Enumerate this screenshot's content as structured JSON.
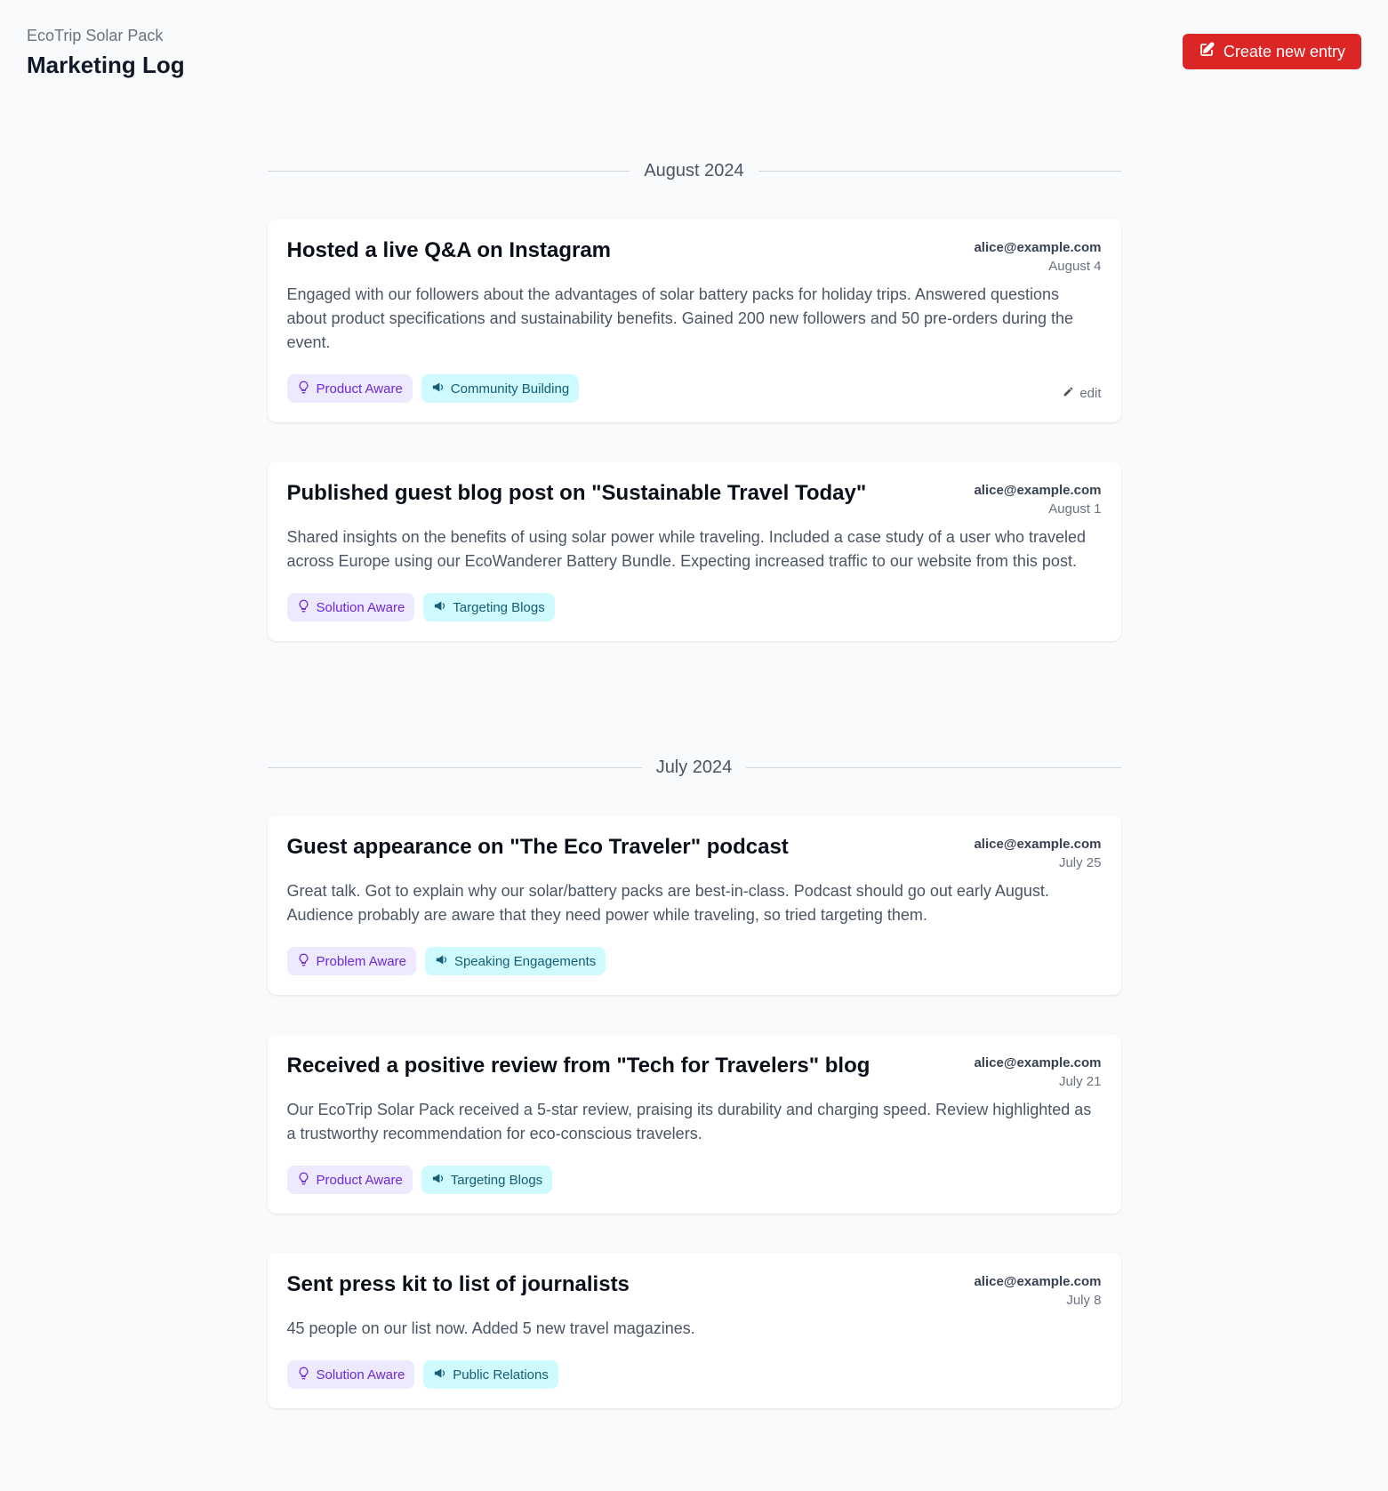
{
  "header": {
    "brand": "EcoTrip Solar Pack",
    "title": "Marketing Log",
    "create_button": "Create new entry"
  },
  "colors": {
    "accent": "#dc2626",
    "awareness_tag_bg": "#ede9fe",
    "awareness_tag_text": "#6d28d9",
    "channel_tag_bg": "#cffafe",
    "channel_tag_text": "#155e75"
  },
  "months": [
    {
      "label": "August 2024",
      "entries": [
        {
          "title": "Hosted a live Q&A on Instagram",
          "author": "alice@example.com",
          "date": "August 4",
          "body": "Engaged with our followers about the advantages of solar battery packs for holiday trips. Answered questions about product specifications and sustainability benefits. Gained 200 new followers and 50 pre-orders during the event.",
          "awareness": {
            "icon": "lightbulb-icon",
            "label": "Product Aware"
          },
          "channel": {
            "icon": "megaphone-icon",
            "label": "Community Building"
          },
          "edit_label": "edit"
        },
        {
          "title": "Published guest blog post on \"Sustainable Travel Today\"",
          "author": "alice@example.com",
          "date": "August 1",
          "body": "Shared insights on the benefits of using solar power while traveling. Included a case study of a user who traveled across Europe using our EcoWanderer Battery Bundle. Expecting increased traffic to our website from this post.",
          "awareness": {
            "icon": "lightbulb-icon",
            "label": "Solution Aware"
          },
          "channel": {
            "icon": "megaphone-icon",
            "label": "Targeting Blogs"
          }
        }
      ]
    },
    {
      "label": "July 2024",
      "entries": [
        {
          "title": "Guest appearance on \"The Eco Traveler\" podcast",
          "author": "alice@example.com",
          "date": "July 25",
          "body": "Great talk. Got to explain why our solar/battery packs are best-in-class. Podcast should go out early August. Audience probably are aware that they need power while traveling, so tried targeting them.",
          "awareness": {
            "icon": "lightbulb-icon",
            "label": "Problem Aware"
          },
          "channel": {
            "icon": "megaphone-icon",
            "label": "Speaking Engagements"
          }
        },
        {
          "title": "Received a positive review from \"Tech for Travelers\" blog",
          "author": "alice@example.com",
          "date": "July 21",
          "body": "Our EcoTrip Solar Pack received a 5-star review, praising its durability and charging speed. Review highlighted as a trustworthy recommendation for eco-conscious travelers.",
          "awareness": {
            "icon": "lightbulb-icon",
            "label": "Product Aware"
          },
          "channel": {
            "icon": "megaphone-icon",
            "label": "Targeting Blogs"
          }
        },
        {
          "title": "Sent press kit to list of journalists",
          "author": "alice@example.com",
          "date": "July 8",
          "body": "45 people on our list now. Added 5 new travel magazines.",
          "awareness": {
            "icon": "lightbulb-icon",
            "label": "Solution Aware"
          },
          "channel": {
            "icon": "megaphone-icon",
            "label": "Public Relations"
          }
        }
      ]
    }
  ]
}
